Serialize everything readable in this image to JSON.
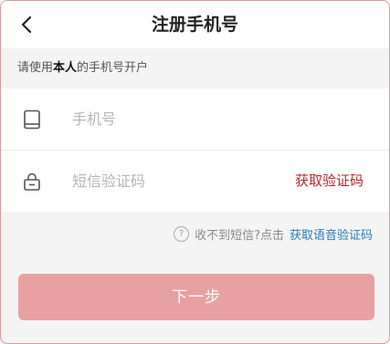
{
  "header": {
    "title": "注册手机号"
  },
  "hint": {
    "prefix": "请使用",
    "strong": "本人",
    "suffix": "的手机号开户"
  },
  "form": {
    "phone_placeholder": "手机号",
    "phone_value": "",
    "code_placeholder": "短信验证码",
    "code_value": "",
    "get_code_label": "获取验证码"
  },
  "voice": {
    "question_mark": "?",
    "text": "收不到短信?点击",
    "link_label": "获取语音验证码"
  },
  "actions": {
    "next_label": "下一步"
  },
  "colors": {
    "accent": "#b8262c",
    "link": "#2b7bb5",
    "button_disabled": "#e8a1a1"
  },
  "icons": {
    "back": "chevron-left-icon",
    "phone": "tablet-icon",
    "code": "lock-icon",
    "help": "help-circle-icon"
  }
}
